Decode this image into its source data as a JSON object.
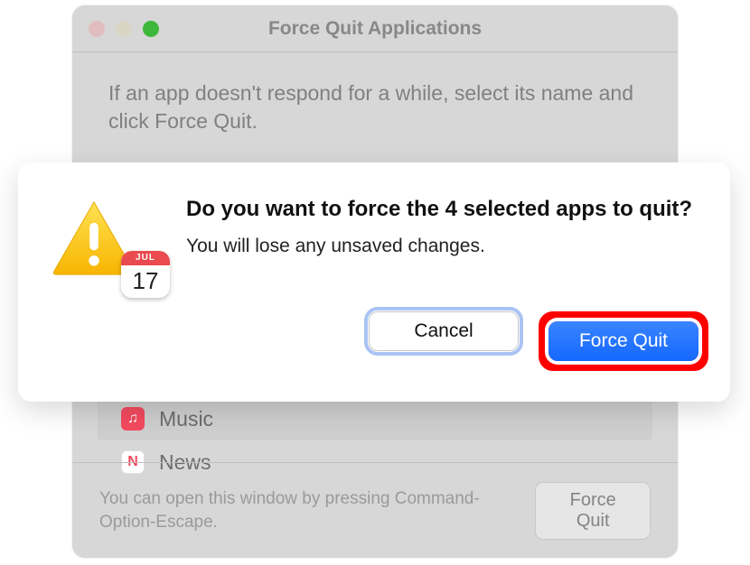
{
  "window": {
    "title": "Force Quit Applications",
    "instruction": "If an app doesn't respond for a while, select its name and click Force Quit.",
    "footer_text": "You can open this window by pressing Command-Option-Escape.",
    "force_quit_label": "Force Quit"
  },
  "apps": [
    {
      "name": "Music",
      "icon": "music-icon",
      "glyph": "♫"
    },
    {
      "name": "News",
      "icon": "news-icon",
      "glyph": "N"
    }
  ],
  "dialog": {
    "title": "Do you want to force the 4 selected apps to quit?",
    "message": "You will lose any unsaved changes.",
    "cancel_label": "Cancel",
    "confirm_label": "Force Quit",
    "calendar_month": "JUL",
    "calendar_day": "17"
  }
}
